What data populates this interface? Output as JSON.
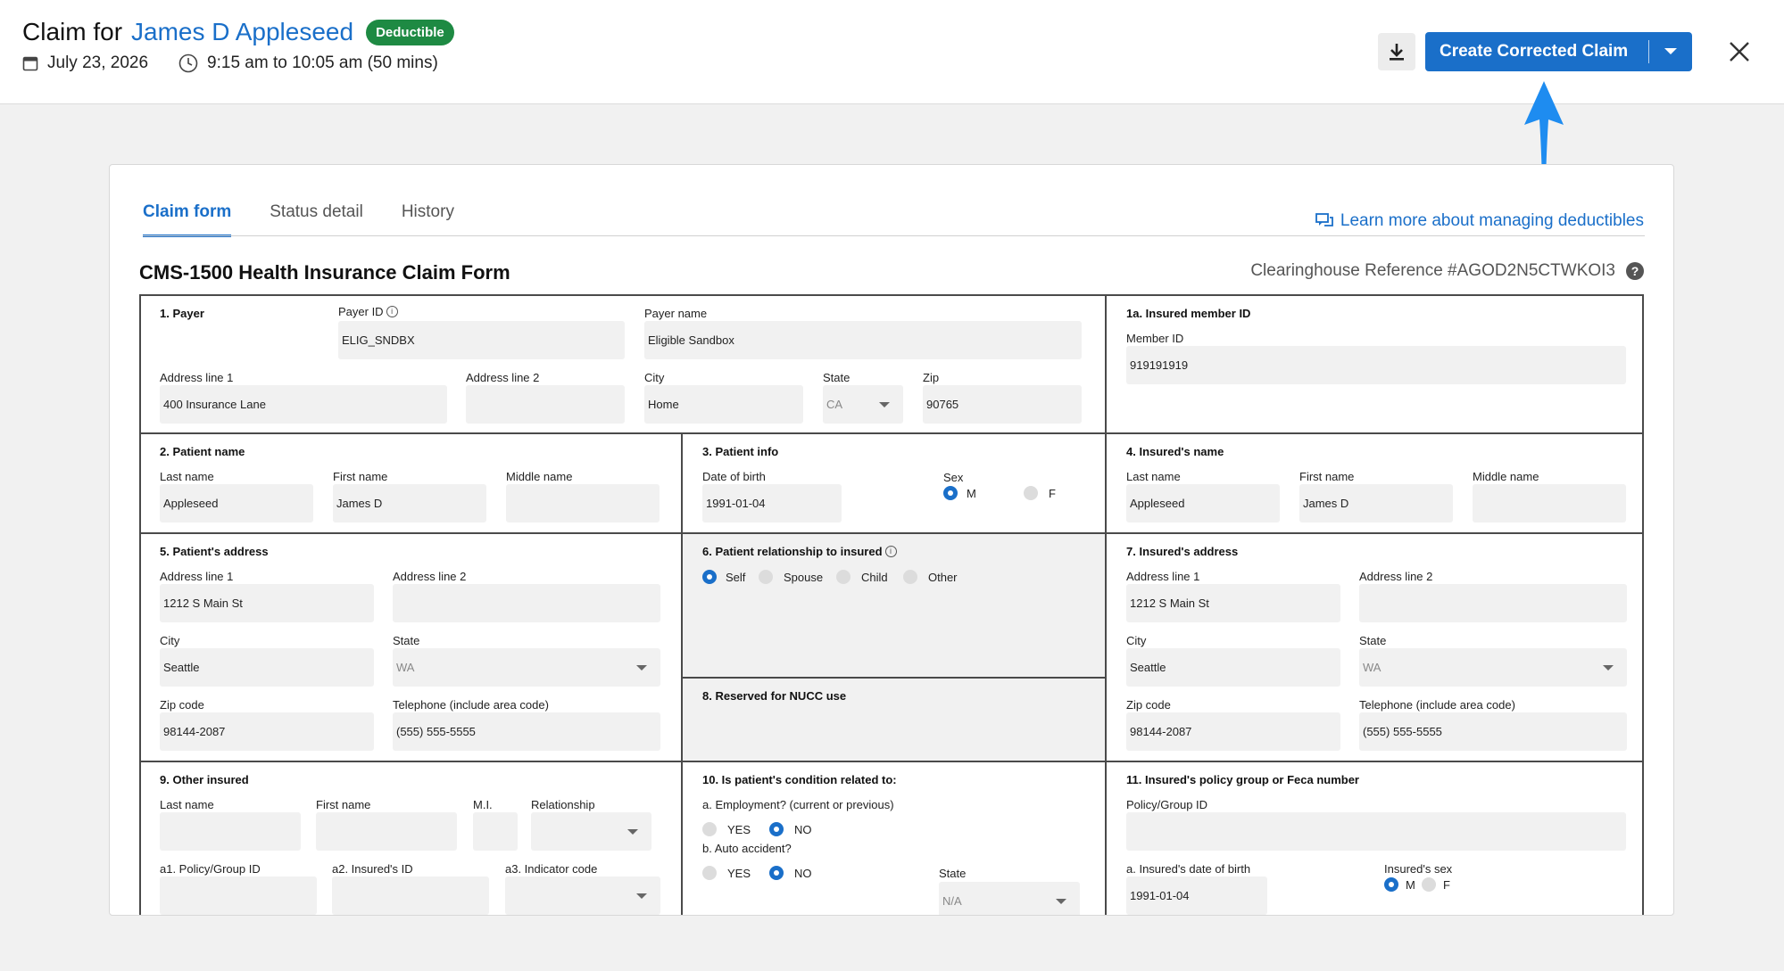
{
  "header": {
    "title_prefix": "Claim for",
    "patient_name": "James D Appleseed",
    "badge": "Deductible",
    "date": "July 23, 2026",
    "time": "9:15 am to 10:05 am (50 mins)",
    "primary_button": "Create Corrected Claim"
  },
  "tabs": [
    {
      "label": "Claim form",
      "active": true
    },
    {
      "label": "Status detail",
      "active": false
    },
    {
      "label": "History",
      "active": false
    }
  ],
  "learn_link": "Learn more about managing deductibles",
  "form": {
    "title": "CMS-1500 Health Insurance Claim Form",
    "reference": "Clearinghouse Reference #AGOD2N5CTWKOI3",
    "payer": {
      "title": "1. Payer",
      "payer_id_label": "Payer ID",
      "payer_id": "ELIG_SNDBX",
      "payer_name_label": "Payer name",
      "payer_name": "Eligible Sandbox",
      "addr1_label": "Address line 1",
      "addr1": "400 Insurance Lane",
      "addr2_label": "Address line 2",
      "addr2": "",
      "city_label": "City",
      "city": "Home",
      "state_label": "State",
      "state": "CA",
      "zip_label": "Zip",
      "zip": "90765"
    },
    "insured_member": {
      "title": "1a. Insured member ID",
      "member_id_label": "Member ID",
      "member_id": "919191919"
    },
    "patient_name": {
      "title": "2. Patient name",
      "last_label": "Last name",
      "last": "Appleseed",
      "first_label": "First name",
      "first": "James D",
      "middle_label": "Middle name",
      "middle": ""
    },
    "patient_info": {
      "title": "3. Patient info",
      "dob_label": "Date of birth",
      "dob": "1991-01-04",
      "sex_label": "Sex",
      "male": "M",
      "female": "F",
      "selected": "M"
    },
    "insured_name": {
      "title": "4. Insured's name",
      "last_label": "Last name",
      "last": "Appleseed",
      "first_label": "First name",
      "first": "James D",
      "middle_label": "Middle name",
      "middle": ""
    },
    "patient_address": {
      "title": "5. Patient's address",
      "addr1_label": "Address line 1",
      "addr1": "1212 S Main St",
      "addr2_label": "Address line 2",
      "addr2": "",
      "city_label": "City",
      "city": "Seattle",
      "state_label": "State",
      "state": "WA",
      "zip_label": "Zip code",
      "zip": "98144-2087",
      "phone_label": "Telephone (include area code)",
      "phone": "(555) 555-5555"
    },
    "relationship": {
      "title": "6. Patient relationship to insured",
      "options": [
        "Self",
        "Spouse",
        "Child",
        "Other"
      ],
      "selected": "Self"
    },
    "insured_address": {
      "title": "7. Insured's address",
      "addr1_label": "Address line 1",
      "addr1": "1212 S Main St",
      "addr2_label": "Address line 2",
      "addr2": "",
      "city_label": "City",
      "city": "Seattle",
      "state_label": "State",
      "state": "WA",
      "zip_label": "Zip code",
      "zip": "98144-2087",
      "phone_label": "Telephone (include area code)",
      "phone": "(555) 555-5555"
    },
    "nucc": {
      "title": "8. Reserved for NUCC use"
    },
    "other_insured": {
      "title": "9. Other insured",
      "last_label": "Last name",
      "first_label": "First name",
      "mi_label": "M.I.",
      "relationship_label": "Relationship",
      "policy_label": "a1. Policy/Group ID",
      "insured_id_label": "a2. Insured's ID",
      "indicator_label": "a3. Indicator code"
    },
    "condition": {
      "title": "10. Is patient's condition related to:",
      "employment_label": "a. Employment? (current or previous)",
      "auto_label": "b. Auto accident?",
      "yes": "YES",
      "no": "NO",
      "employment": "NO",
      "auto": "NO",
      "state_label": "State",
      "state": "N/A"
    },
    "policy_group": {
      "title": "11. Insured's policy group or Feca number",
      "policy_label": "Policy/Group ID",
      "policy": "",
      "dob_label": "a. Insured's date of birth",
      "dob": "1991-01-04",
      "sex_label": "Insured's sex",
      "male": "M",
      "female": "F",
      "selected": "M"
    }
  }
}
